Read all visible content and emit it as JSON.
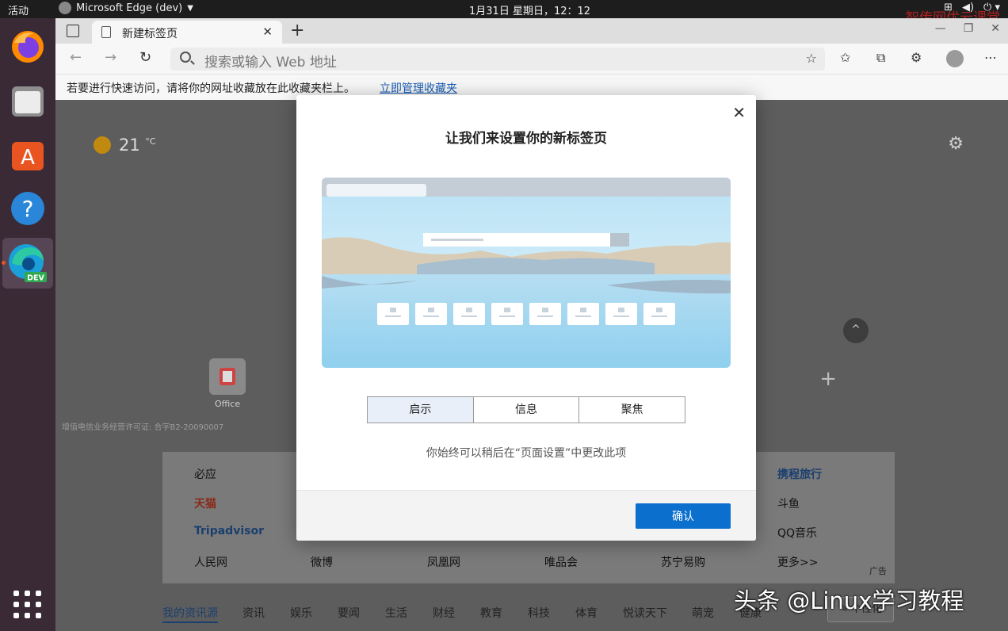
{
  "system_bar": {
    "activities": "活动",
    "app_name": "Microsoft Edge (dev)",
    "clock": "1月31日 星期日，12：12",
    "watermark": "智传网优云课堂"
  },
  "dock": {
    "items": [
      "firefox-icon",
      "files-icon",
      "software-icon",
      "help-icon",
      "edge-dev-icon"
    ],
    "edge_badge": "DEV"
  },
  "browser": {
    "tab_title": "新建标签页",
    "address_placeholder": "搜索或输入 Web 地址",
    "favorites_message": "若要进行快速访问，请将你的网址收藏放在此收藏夹栏上。",
    "favorites_link": "立即管理收藏夹"
  },
  "ntp": {
    "temperature": "21",
    "temperature_unit": "°C",
    "quick_link_label": "Office",
    "icp_text": "增值电信业务经营许可证: 合字B2-20090007",
    "links": {
      "col1": [
        "必应",
        "天猫",
        "Tripadvisor",
        "人民网"
      ],
      "col2": [
        "微博"
      ],
      "col3": [
        "凤凰网"
      ],
      "col4": [
        "唯品会"
      ],
      "col5": [
        "苏宁易购"
      ],
      "col6": [
        "携程旅行",
        "斗鱼",
        "QQ音乐",
        "更多>>"
      ]
    },
    "ad_label": "广告",
    "feed_tabs": [
      "我的资讯源",
      "资讯",
      "娱乐",
      "要闻",
      "生活",
      "财经",
      "教育",
      "科技",
      "体育",
      "悦读天下",
      "萌宠",
      "健康"
    ],
    "personalize": "个性化"
  },
  "modal": {
    "title": "让我们来设置你的新标签页",
    "options": [
      "启示",
      "信息",
      "聚焦"
    ],
    "selected_option": "启示",
    "hint": "你始终可以稍后在“页面设置”中更改此项",
    "confirm": "确认"
  },
  "overlay_watermark": "头条 @Linux学习教程",
  "colors": {
    "accent": "#0b6fce",
    "dock_bg": "#3a2a35",
    "topbar_bg": "#1d1d1d"
  }
}
